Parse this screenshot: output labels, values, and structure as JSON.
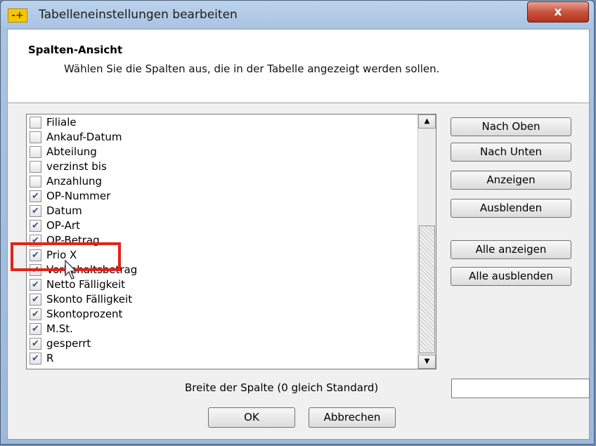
{
  "window": {
    "title": "Tabelleneinstellungen bearbeiten",
    "app_icon_glyph": "-+",
    "close_glyph": "x"
  },
  "header": {
    "title": "Spalten-Ansicht",
    "description": "Wählen Sie die Spalten aus, die in der Tabelle angezeigt werden sollen."
  },
  "columns": [
    {
      "label": "Filiale",
      "checked": false
    },
    {
      "label": "Ankauf-Datum",
      "checked": false
    },
    {
      "label": "Abteilung",
      "checked": false
    },
    {
      "label": "verzinst bis",
      "checked": false
    },
    {
      "label": "Anzahlung",
      "checked": false
    },
    {
      "label": "OP-Nummer",
      "checked": true
    },
    {
      "label": "Datum",
      "checked": true
    },
    {
      "label": "OP-Art",
      "checked": true
    },
    {
      "label": "OP-Betrag",
      "checked": true
    },
    {
      "label": "Prio X",
      "checked": true
    },
    {
      "label": "Vorbehaltsbetrag",
      "checked": true
    },
    {
      "label": "Netto Fälligkeit",
      "checked": true
    },
    {
      "label": "Skonto Fälligkeit",
      "checked": true
    },
    {
      "label": "Skontoprozent",
      "checked": true
    },
    {
      "label": "M.St.",
      "checked": true
    },
    {
      "label": "gesperrt",
      "checked": true
    },
    {
      "label": "R",
      "checked": true
    }
  ],
  "check_glyph": "✔",
  "scrollbar": {
    "up": "▲",
    "down": "▼"
  },
  "buttons": {
    "move_up": "Nach Oben",
    "move_down": "Nach Unten",
    "show": "Anzeigen",
    "hide": "Ausblenden",
    "show_all": "Alle anzeigen",
    "hide_all": "Alle ausblenden"
  },
  "width_field": {
    "label": "Breite der Spalte (0 gleich Standard)",
    "value": ""
  },
  "dialog_buttons": {
    "ok": "OK",
    "cancel": "Abbrechen"
  },
  "colors": {
    "highlight": "#e0241b",
    "check": "#38598f"
  }
}
